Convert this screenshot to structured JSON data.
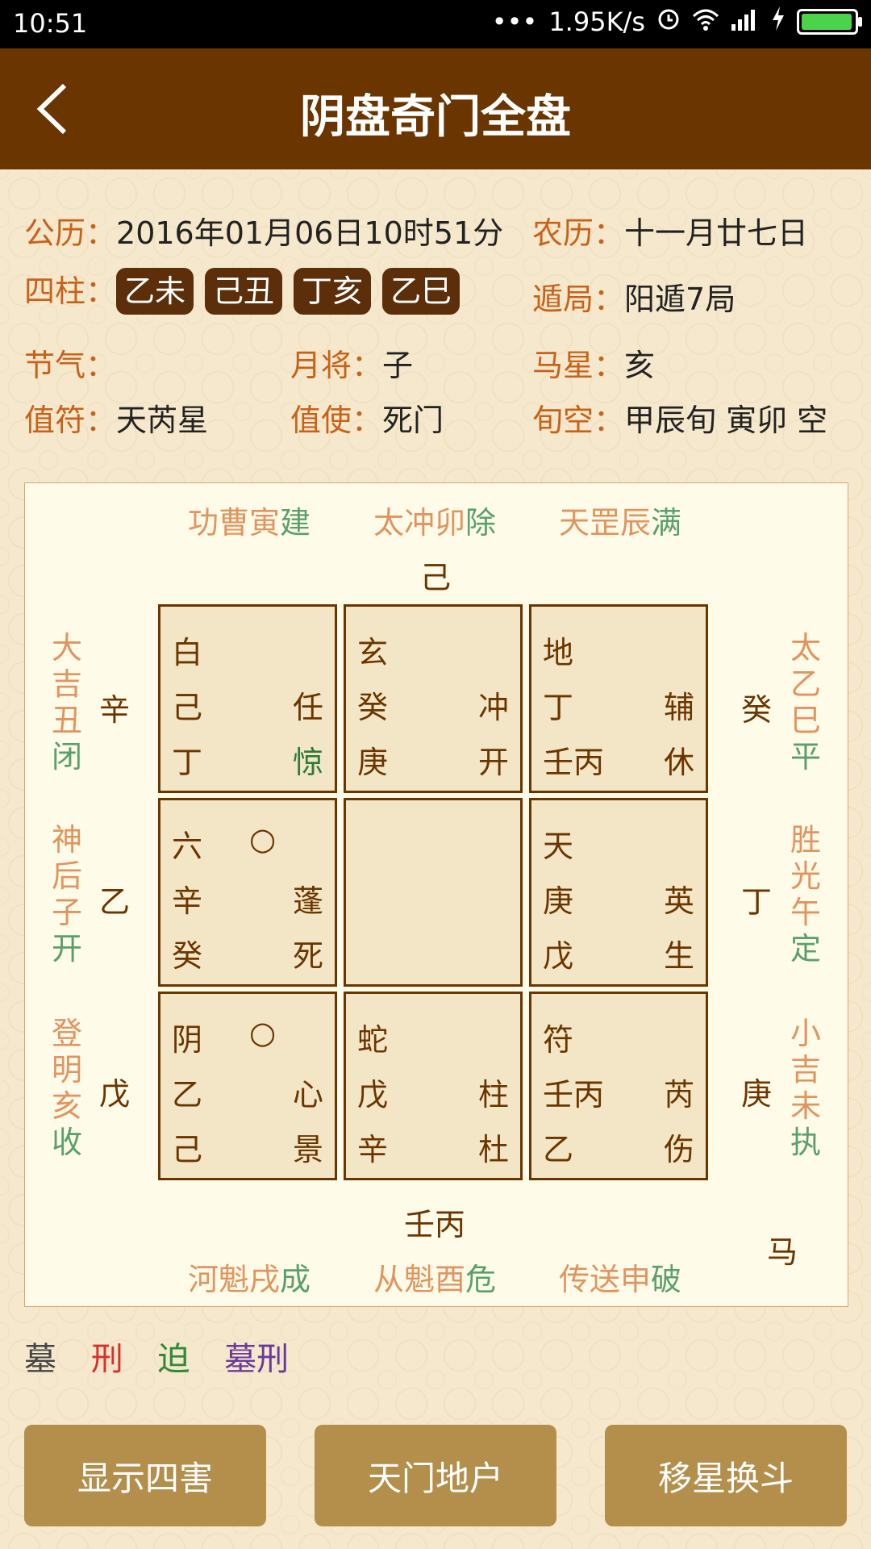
{
  "status": {
    "time": "10:51",
    "dots": "•••",
    "speed": "1.95K/s"
  },
  "header": {
    "title": "阴盘奇门全盘"
  },
  "info": {
    "gongli_label": "公历：",
    "gongli_value": "2016年01月06日10时51分",
    "nongli_label": "农历：",
    "nongli_value": "十一月廿七日",
    "sizhu_label": "四柱：",
    "sizhu": [
      "乙未",
      "己丑",
      "丁亥",
      "乙巳"
    ],
    "dunju_label": "遁局：",
    "dunju_value": "阳遁7局",
    "jieqi_label": "节气：",
    "jieqi_value": "",
    "yuejiang_label": "月将：",
    "yuejiang_value": "子",
    "maxing_label": "马星：",
    "maxing_value": "亥",
    "zhifu_label": "值符：",
    "zhifu_value": "天芮星",
    "zhishi_label": "值使：",
    "zhishi_value": "死门",
    "xunkong_label": "旬空：",
    "xunkong_value": "甲辰旬 寅卯 空"
  },
  "board": {
    "top_labels": [
      {
        "a": "功曹寅",
        "b": "建"
      },
      {
        "a": "太冲卯",
        "b": "除"
      },
      {
        "a": "天罡辰",
        "b": "满"
      }
    ],
    "top_stem": "己",
    "bottom_labels": [
      {
        "a": "河魁戌",
        "b": "成"
      },
      {
        "a": "从魁酉",
        "b": "危"
      },
      {
        "a": "传送申",
        "b": "破"
      }
    ],
    "bottom_stem": "壬丙",
    "ma": "马",
    "left_labels": [
      {
        "chars": [
          "大",
          "吉",
          "丑"
        ],
        "last": "闭"
      },
      {
        "chars": [
          "神",
          "后",
          "子"
        ],
        "last": "开"
      },
      {
        "chars": [
          "登",
          "明",
          "亥"
        ],
        "last": "收"
      }
    ],
    "right_labels": [
      {
        "chars": [
          "太",
          "乙",
          "巳"
        ],
        "last": "平"
      },
      {
        "chars": [
          "胜",
          "光",
          "午"
        ],
        "last": "定"
      },
      {
        "chars": [
          "小",
          "吉",
          "未"
        ],
        "last": "执"
      }
    ],
    "left_stems": [
      "辛",
      "乙",
      "戊"
    ],
    "right_stems": [
      "癸",
      "丁",
      "庚"
    ],
    "cells": [
      {
        "god": "白",
        "circle": "",
        "s1": "己",
        "r1": "任",
        "s2": "丁",
        "r2": "惊",
        "r2_color": "#2f7a3a"
      },
      {
        "god": "玄",
        "circle": "",
        "s1": "癸",
        "r1": "冲",
        "s2": "庚",
        "r2": "开",
        "r2_color": ""
      },
      {
        "god": "地",
        "circle": "",
        "s1": "丁",
        "r1": "辅",
        "s2": "壬丙",
        "r2": "休",
        "r2_color": ""
      },
      {
        "god": "六",
        "circle": "○",
        "s1": "辛",
        "r1": "蓬",
        "s2": "癸",
        "r2": "死",
        "r2_color": ""
      },
      {
        "god": "",
        "circle": "",
        "s1": "",
        "r1": "",
        "s2": "",
        "r2": "",
        "r2_color": ""
      },
      {
        "god": "天",
        "circle": "",
        "s1": "庚",
        "r1": "英",
        "s2": "戊",
        "r2": "生",
        "r2_color": ""
      },
      {
        "god": "阴",
        "circle": "○",
        "s1": "乙",
        "r1": "心",
        "s2": "己",
        "r2": "景",
        "r2_color": ""
      },
      {
        "god": "蛇",
        "circle": "",
        "s1": "戊",
        "r1": "柱",
        "s2": "辛",
        "r2": "杜",
        "r2_color": ""
      },
      {
        "god": "符",
        "circle": "",
        "s1": "壬丙",
        "r1": "芮",
        "s2": "乙",
        "r2": "伤",
        "r2_color": ""
      }
    ]
  },
  "legend": [
    {
      "text": "墓",
      "color": "#444444"
    },
    {
      "text": "刑",
      "color": "#d9302a"
    },
    {
      "text": "迫",
      "color": "#2f8a3a"
    },
    {
      "text": "墓刑",
      "color": "#6a3a9a"
    }
  ],
  "buttons": [
    {
      "label": "显示四害"
    },
    {
      "label": "天门地户"
    },
    {
      "label": "移星换斗"
    }
  ],
  "colors": {
    "header_bg": "#6b3500",
    "label": "#c8621a",
    "button": "#b48f4b",
    "pill": "#5c2e0a"
  }
}
